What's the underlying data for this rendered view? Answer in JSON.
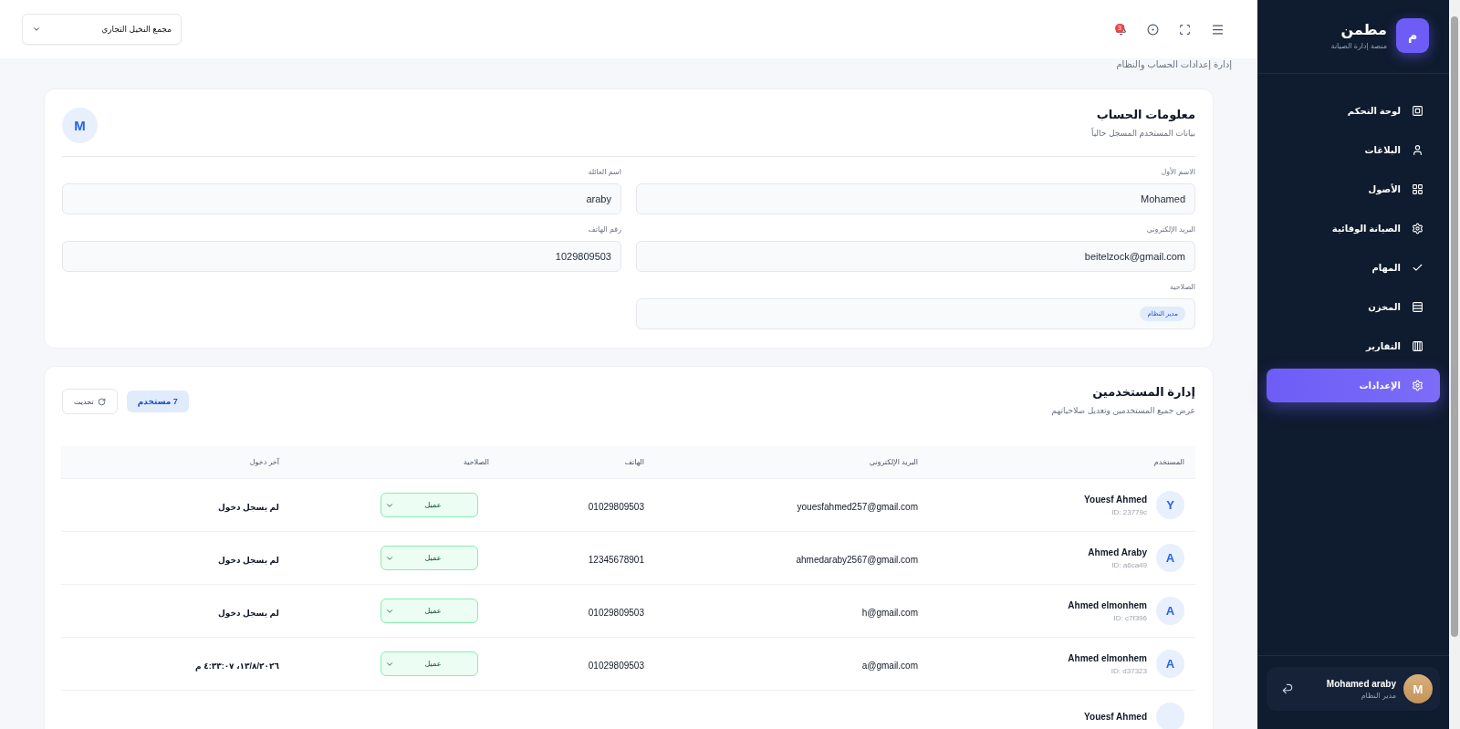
{
  "header": {
    "org_select": {
      "value": "مجمع النخيل التجاري"
    },
    "notifications": {
      "count": "3"
    }
  },
  "page_subtitle": "إدارة إعدادات الحساب والنظام",
  "account": {
    "title": "معلومات الحساب",
    "subtitle": "بيانات المستخدم المسجل حالياً",
    "avatar": "M",
    "fields": [
      {
        "label": "الاسم الأول",
        "value": "Mohamed",
        "kind": "text"
      },
      {
        "label": "اسم العائلة",
        "value": "araby",
        "kind": "text"
      },
      {
        "label": "البريد الإلكتروني",
        "value": "beitelzock@gmail.com",
        "kind": "text"
      },
      {
        "label": "رقم الهاتف",
        "value": "1029809503",
        "kind": "text"
      },
      {
        "label": "الصلاحية",
        "value": "مدير النظام",
        "kind": "badge"
      }
    ]
  },
  "users": {
    "title": "إدارة المستخدمين",
    "subtitle": "عرض جميع المستخدمين وتعديل صلاحياتهم",
    "count_badge": "7 مستخدم",
    "refresh_button": "تحديث",
    "columns": [
      "المستخدم",
      "البريد الإلكتروني",
      "الهاتف",
      "الصلاحية",
      "آخر دخول"
    ],
    "rows": [
      {
        "avatar": "Y",
        "name": "Youesf Ahmed",
        "id": "ID: 23779c",
        "email": "youesfahmed257@gmail.com",
        "phone": "01029809503",
        "role": "عميل",
        "last_login": "لم يسجل دخول"
      },
      {
        "avatar": "A",
        "name": "Ahmed Araby",
        "id": "ID: a6ca49",
        "email": "ahmedaraby2567@gmail.com",
        "phone": "12345678901",
        "role": "عميل",
        "last_login": "لم يسجل دخول"
      },
      {
        "avatar": "A",
        "name": "Ahmed elmonhem",
        "id": "ID: c7f396",
        "email": "h@gmail.com",
        "phone": "01029809503",
        "role": "عميل",
        "last_login": "لم يسجل دخول"
      },
      {
        "avatar": "A",
        "name": "Ahmed elmonhem",
        "id": "ID: d37323",
        "email": "a@gmail.com",
        "phone": "01029809503",
        "role": "عميل",
        "last_login": "١٣/٨/٢٠٢٦، ٤:٣٣:٠٧ م"
      },
      {
        "name": "Youesf Ahmed"
      }
    ]
  },
  "sidebar": {
    "logo": "م",
    "title": "مطمن",
    "subtitle": "منصة إدارة الصيانة",
    "items": [
      {
        "label": "لوحة التحكم",
        "selected": false
      },
      {
        "label": "البلاغات",
        "selected": false
      },
      {
        "label": "الأصول",
        "selected": false
      },
      {
        "label": "الصيانة الوقائية",
        "selected": false
      },
      {
        "label": "المهام",
        "selected": false
      },
      {
        "label": "المخزن",
        "selected": false
      },
      {
        "label": "التقارير",
        "selected": false
      },
      {
        "label": "الإعدادات",
        "selected": true
      }
    ],
    "user": {
      "avatar": "M",
      "name": "Mohamed araby",
      "role": "مدير النظام"
    }
  }
}
